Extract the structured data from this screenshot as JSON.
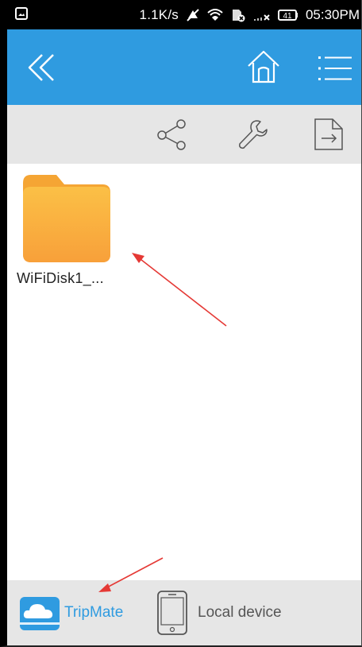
{
  "status_bar": {
    "speed": "1.1K/s",
    "battery_level": "41",
    "time": "05:30PM",
    "icons": [
      "gallery-icon",
      "mute-icon",
      "wifi-icon",
      "sim-off-icon",
      "signal-icon",
      "battery-icon"
    ]
  },
  "title_bar": {
    "background": "#2f9be0",
    "icons": [
      "double-chevron-left-icon",
      "home-icon",
      "menu-icon"
    ]
  },
  "toolbar": {
    "icons": [
      "share-icon",
      "wrench-icon",
      "export-icon"
    ]
  },
  "files": [
    {
      "name": "WiFiDisk1_...",
      "type": "folder",
      "icon": "folder-icon"
    }
  ],
  "bottom_nav": {
    "tabs": [
      {
        "label": "TripMate",
        "icon": "cloud-drive-icon",
        "active": true
      },
      {
        "label": "Local device",
        "icon": "phone-icon",
        "active": false
      }
    ]
  },
  "colors": {
    "accent": "#2f9be0",
    "folder_top": "#fbbf45",
    "folder_bottom": "#f9a23b",
    "arrow": "#e53935"
  }
}
